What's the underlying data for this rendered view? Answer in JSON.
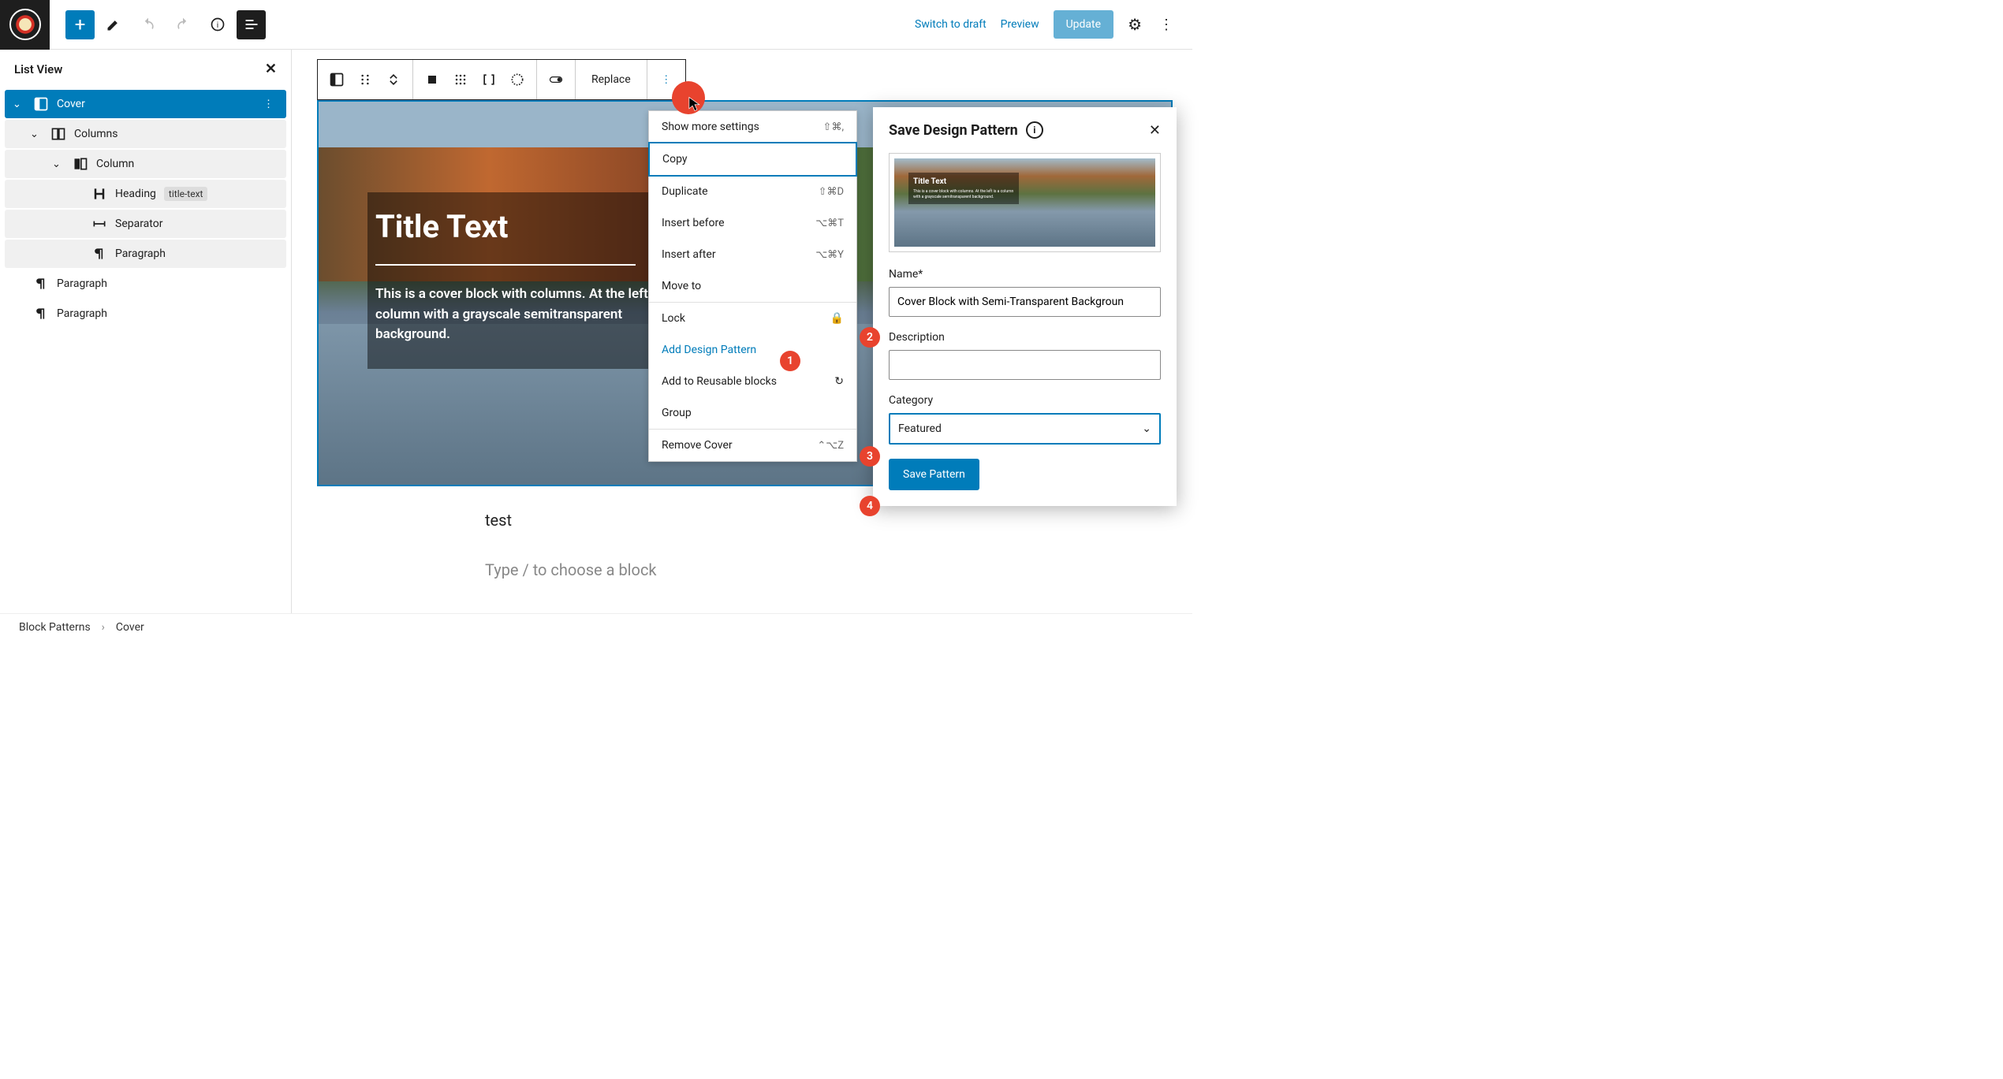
{
  "toolbar": {
    "switch_draft": "Switch to draft",
    "preview": "Preview",
    "update": "Update"
  },
  "sidebar": {
    "title": "List View",
    "items": [
      {
        "label": "Cover",
        "icon": "cover",
        "selected": true,
        "indent": 0,
        "expandable": true
      },
      {
        "label": "Columns",
        "icon": "columns",
        "indent": 1,
        "expandable": true,
        "selected_child": true
      },
      {
        "label": "Column",
        "icon": "column",
        "indent": 2,
        "expandable": true,
        "selected_child": true
      },
      {
        "label": "Heading",
        "icon": "heading",
        "badge": "title-text",
        "indent": 3,
        "selected_child": true
      },
      {
        "label": "Separator",
        "icon": "separator",
        "indent": 3,
        "selected_child": true
      },
      {
        "label": "Paragraph",
        "icon": "paragraph",
        "indent": 3,
        "selected_child": true
      },
      {
        "label": "Paragraph",
        "icon": "paragraph",
        "indent": 0
      },
      {
        "label": "Paragraph",
        "icon": "paragraph",
        "indent": 0
      }
    ]
  },
  "block_toolbar": {
    "replace": "Replace"
  },
  "cover": {
    "title": "Title Text",
    "paragraph": "This is a cover block with columns. At the left is a column with a grayscale semitransparent background."
  },
  "canvas": {
    "test_text": "test",
    "placeholder": "Type / to choose a block"
  },
  "context_menu": {
    "items": [
      {
        "label": "Show more settings",
        "shortcut": "⇧⌘,"
      },
      {
        "label": "Copy",
        "highlighted": true
      },
      {
        "label": "Duplicate",
        "shortcut": "⇧⌘D"
      },
      {
        "label": "Insert before",
        "shortcut": "⌥⌘T"
      },
      {
        "label": "Insert after",
        "shortcut": "⌥⌘Y"
      },
      {
        "label": "Move to"
      },
      {
        "sep": true
      },
      {
        "label": "Lock",
        "icon": "lock"
      },
      {
        "label": "Add Design Pattern",
        "link": true,
        "annot": "1"
      },
      {
        "label": "Add to Reusable blocks",
        "icon": "reuse"
      },
      {
        "label": "Group"
      },
      {
        "sep": true
      },
      {
        "label": "Remove Cover",
        "shortcut": "⌃⌥Z"
      }
    ]
  },
  "modal": {
    "title": "Save Design Pattern",
    "preview_title": "Title Text",
    "preview_text": "This is a cover block with columns. At the left is a column with a grayscale semitransparent background.",
    "name_label": "Name*",
    "name_value": "Cover Block with Semi-Transparent Backgroun",
    "desc_label": "Description",
    "desc_value": "",
    "cat_label": "Category",
    "cat_value": "Featured",
    "save_btn": "Save Pattern"
  },
  "breadcrumb": {
    "items": [
      "Block Patterns",
      "Cover"
    ]
  },
  "annotations": {
    "a1": "1",
    "a2": "2",
    "a3": "3",
    "a4": "4"
  }
}
